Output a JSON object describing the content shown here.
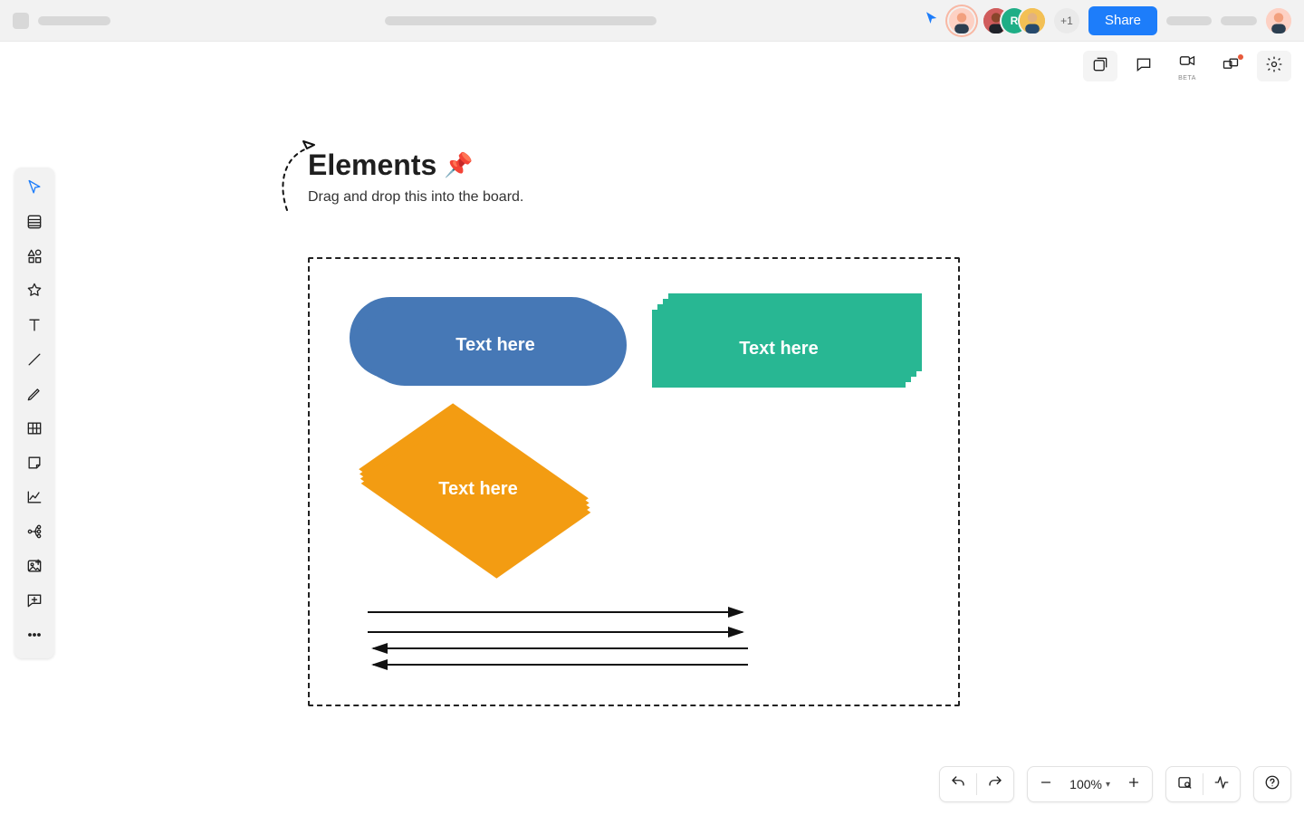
{
  "header": {
    "share_label": "Share",
    "avatar_overflow": "+1",
    "avatar3_initial": "R"
  },
  "topright": {
    "beta_label": "BETA"
  },
  "canvas": {
    "title": "Elements",
    "title_emoji": "📌",
    "subtitle": "Drag and drop this into the board.",
    "shape_blue_label": "Text here",
    "shape_green_label": "Text here",
    "shape_diamond_label": "Text here"
  },
  "zoom": {
    "level": "100%"
  }
}
